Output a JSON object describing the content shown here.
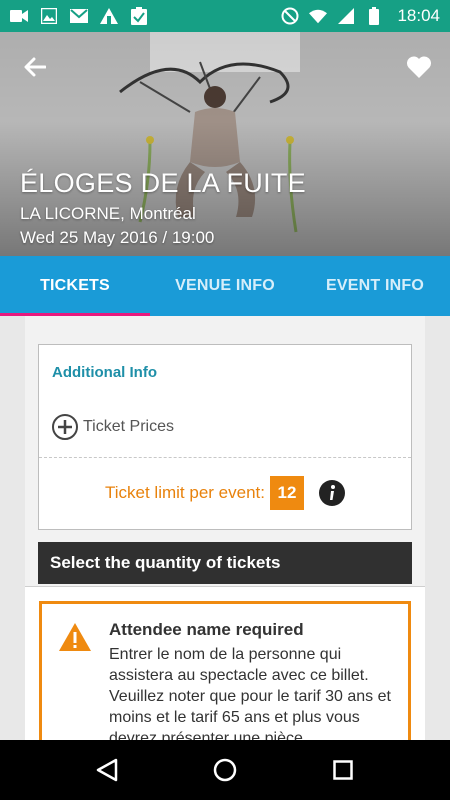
{
  "status_bar": {
    "time": "18:04",
    "left_icons": [
      "video-icon",
      "image-icon",
      "gmail-icon",
      "app-icon",
      "clipboard-check-icon"
    ],
    "right_icons": [
      "do-not-disturb-icon",
      "wifi-icon",
      "signal-icon",
      "battery-icon"
    ],
    "background": "#16a085"
  },
  "hero": {
    "title": "ÉLOGES DE LA FUITE",
    "venue": "LA LICORNE, Montréal",
    "date": "Wed 25 May 2016 / 19:00",
    "back_icon": "arrow-left-icon",
    "favorite_icon": "heart-icon"
  },
  "tabs": [
    {
      "label": "TICKETS",
      "active": true
    },
    {
      "label": "VENUE INFO",
      "active": false
    },
    {
      "label": "EVENT INFO",
      "active": false
    }
  ],
  "colors": {
    "tab_bar": "#1a9bd7",
    "tab_indicator": "#e8197e",
    "accent_orange": "#ef8a10",
    "info_title": "#1e8fa8"
  },
  "info_card": {
    "title": "Additional Info",
    "ticket_prices_label": "Ticket Prices",
    "limit_label": "Ticket limit per event:",
    "limit_value": "12"
  },
  "quantity_header": "Select the quantity of tickets",
  "attendee_notice": {
    "title": "Attendee name required",
    "text": "Entrer le nom de la personne qui assistera au spectacle avec ce billet. Veuillez noter que pour le tarif 30 ans et moins et le tarif 65 ans et plus vous devrez présenter une pièce"
  },
  "nav_bar": {
    "buttons": [
      "back-triangle-icon",
      "home-circle-icon",
      "recents-square-icon"
    ]
  }
}
